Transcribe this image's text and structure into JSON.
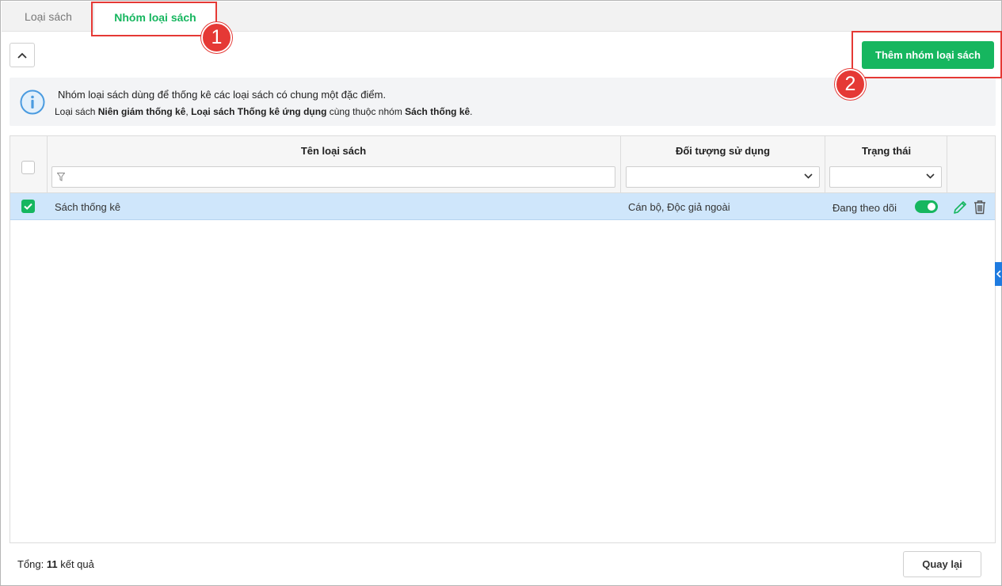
{
  "tabs": [
    {
      "label": "Loại sách",
      "active": false
    },
    {
      "label": "Nhóm loại sách",
      "active": true
    }
  ],
  "annotations": {
    "badge_1": "1",
    "badge_2": "2"
  },
  "toolbar": {
    "add_label": "Thêm nhóm loại sách"
  },
  "info": {
    "line1": "Nhóm loại sách dùng để thống kê các loại sách có chung một đặc điểm.",
    "line2_prefix": "Loại sách ",
    "line2_bold1": "Niên giám thống kê",
    "line2_sep": ", ",
    "line2_bold2": "Loại sách Thống kê ứng dụng",
    "line2_mid": " cùng thuộc nhóm ",
    "line2_bold3": "Sách thống kê",
    "line2_end": "."
  },
  "table": {
    "columns": {
      "name": "Tên loại sách",
      "audience": "Đối tượng sử dụng",
      "status": "Trạng thái"
    },
    "filters": {
      "name": "",
      "audience": "",
      "status": ""
    },
    "rows": [
      {
        "name": "Sách thống kê",
        "audience": "Cán bộ, Độc giả ngoài",
        "status": "Đang theo dõi",
        "checked": true,
        "active": true
      }
    ]
  },
  "footer": {
    "total_prefix": "Tổng: ",
    "total_count": "11",
    "total_suffix": " kết quả",
    "back_label": "Quay lại"
  },
  "colors": {
    "accent": "#16b65f",
    "highlight": "#e53935",
    "row_selected": "#cfe6fb",
    "side_tab": "#1e7be0"
  }
}
